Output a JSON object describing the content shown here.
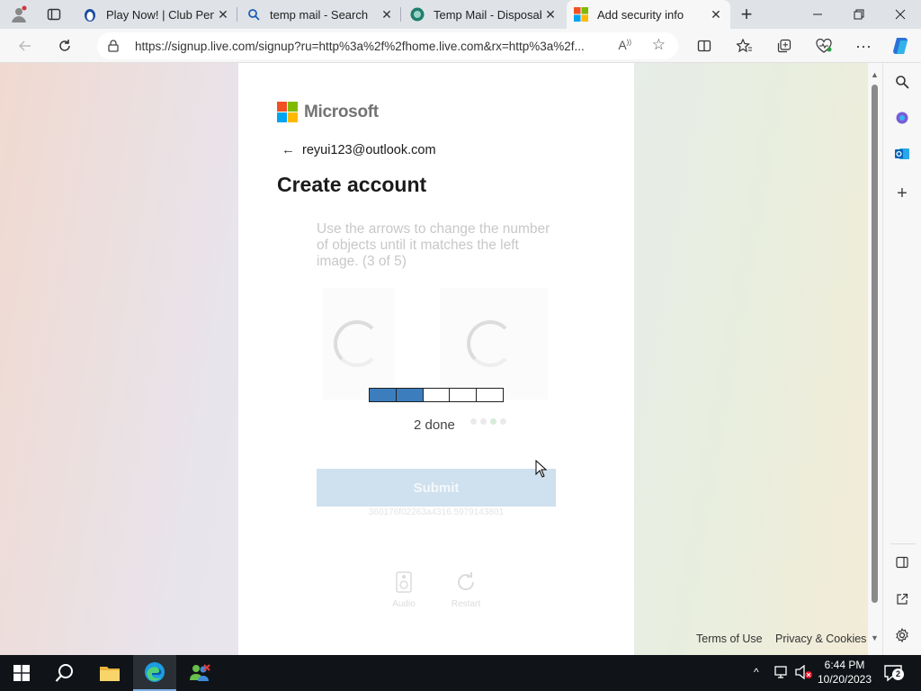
{
  "browser": {
    "tabs": [
      {
        "title": "Play Now! | Club Penguin"
      },
      {
        "title": "temp mail - Search"
      },
      {
        "title": "Temp Mail - Disposable"
      },
      {
        "title": "Add security info",
        "active": true
      }
    ],
    "url": "https://signup.live.com/signup?ru=http%3a%2f%2fhome.live.com&rx=http%3a%2f..."
  },
  "page": {
    "logo_text": "Microsoft",
    "email": "reyui123@outlook.com",
    "title": "Create account",
    "instruction": "Use the arrows to change the number of objects until it matches the left image. (3 of 5)",
    "progress": {
      "total": 5,
      "done": 2
    },
    "done_label": "2 done",
    "submit_label": "Submit",
    "session_id": "360176f02263a4316.5979143801",
    "audio_label": "Audio",
    "restart_label": "Restart",
    "footer": {
      "terms": "Terms of Use",
      "privacy": "Privacy & Cookies"
    }
  },
  "taskbar": {
    "time": "6:44 PM",
    "date": "10/20/2023",
    "notification_count": "2"
  },
  "colors": {
    "ms_red": "#f25022",
    "ms_green": "#7fba00",
    "ms_blue": "#00a4ef",
    "ms_yellow": "#ffb900",
    "progress_done": "#3b7dbd",
    "submit_disabled": "#cfe0ee"
  },
  "icons": [
    "profile-icon",
    "tab-actions-icon",
    "back-icon",
    "refresh-icon",
    "lock-icon",
    "read-aloud-icon",
    "favorite-star-icon",
    "split-screen-icon",
    "favorites-icon",
    "collections-icon",
    "browser-essentials-icon",
    "more-icon",
    "copilot-icon",
    "search-sidebar-icon",
    "outlook-icon",
    "add-icon",
    "windows-start-icon",
    "taskbar-search-icon",
    "file-explorer-icon",
    "edge-icon"
  ]
}
